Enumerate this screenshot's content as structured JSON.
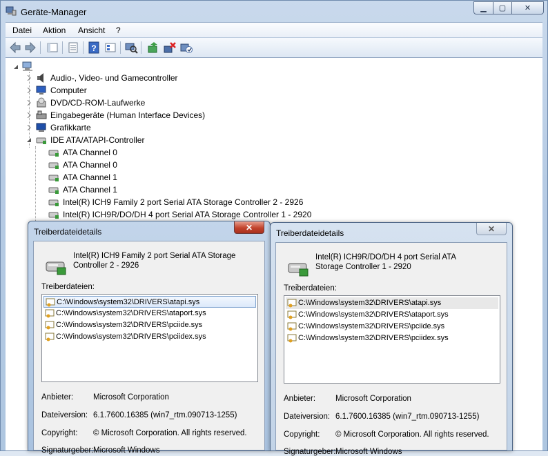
{
  "window": {
    "title": "Geräte-Manager",
    "controls": {
      "minimize": "▁",
      "maximize": "▢",
      "close": "✕"
    }
  },
  "menu": [
    "Datei",
    "Aktion",
    "Ansicht",
    "?"
  ],
  "toolbar": {
    "icons": [
      "back-icon",
      "forward-icon",
      "up-icon",
      "properties-icon",
      "help-icon",
      "tree-view-icon",
      "scan-hardware-icon",
      "update-driver-icon",
      "uninstall-icon",
      "enable-device-icon"
    ]
  },
  "tree": {
    "nodes": [
      {
        "label": "Audio-, Video- und Gamecontroller",
        "icon": "speaker-icon"
      },
      {
        "label": "Computer",
        "icon": "computer-icon"
      },
      {
        "label": "DVD/CD-ROM-Laufwerke",
        "icon": "dvd-drive-icon"
      },
      {
        "label": "Eingabegeräte (Human Interface Devices)",
        "icon": "hid-icon"
      },
      {
        "label": "Grafikkarte",
        "icon": "display-adapter-icon"
      },
      {
        "label": "IDE ATA/ATAPI-Controller",
        "icon": "ide-controller-icon"
      },
      {
        "label": "ATA Channel 0",
        "icon": "ide-controller-icon"
      },
      {
        "label": "ATA Channel 0",
        "icon": "ide-controller-icon"
      },
      {
        "label": "ATA Channel 1",
        "icon": "ide-controller-icon"
      },
      {
        "label": "ATA Channel 1",
        "icon": "ide-controller-icon"
      },
      {
        "label": "Intel(R) ICH9 Family 2 port Serial ATA Storage Controller 2 - 2926",
        "icon": "ide-controller-icon"
      },
      {
        "label": "Intel(R) ICH9R/DO/DH 4 port Serial ATA Storage Controller 1 - 2920",
        "icon": "ide-controller-icon"
      }
    ]
  },
  "dialogs": [
    {
      "title": "Treiberdateidetails",
      "device": "Intel(R) ICH9 Family 2 port Serial ATA Storage Controller 2 - 2926",
      "files_label": "Treiberdateien:",
      "files": [
        "C:\\Windows\\system32\\DRIVERS\\atapi.sys",
        "C:\\Windows\\system32\\DRIVERS\\ataport.sys",
        "C:\\Windows\\system32\\DRIVERS\\pciide.sys",
        "C:\\Windows\\system32\\DRIVERS\\pciidex.sys"
      ],
      "provider_label": "Anbieter:",
      "provider": "Microsoft Corporation",
      "version_label": "Dateiversion:",
      "version": "6.1.7600.16385 (win7_rtm.090713-1255)",
      "copyright_label": "Copyright:",
      "copyright": "© Microsoft Corporation. All rights reserved.",
      "signer_label": "Signaturgeber:",
      "signer": "Microsoft Windows",
      "close": "✕"
    },
    {
      "title": "Treiberdateidetails",
      "device": "Intel(R) ICH9R/DO/DH 4 port Serial ATA Storage Controller 1 - 2920",
      "files_label": "Treiberdateien:",
      "files": [
        "C:\\Windows\\system32\\DRIVERS\\atapi.sys",
        "C:\\Windows\\system32\\DRIVERS\\ataport.sys",
        "C:\\Windows\\system32\\DRIVERS\\pciide.sys",
        "C:\\Windows\\system32\\DRIVERS\\pciidex.sys"
      ],
      "provider_label": "Anbieter:",
      "provider": "Microsoft Corporation",
      "version_label": "Dateiversion:",
      "version": "6.1.7600.16385 (win7_rtm.090713-1255)",
      "copyright_label": "Copyright:",
      "copyright": "© Microsoft Corporation. All rights reserved.",
      "signer_label": "Signaturgeber:",
      "signer": "Microsoft Windows",
      "close": "✕"
    }
  ]
}
